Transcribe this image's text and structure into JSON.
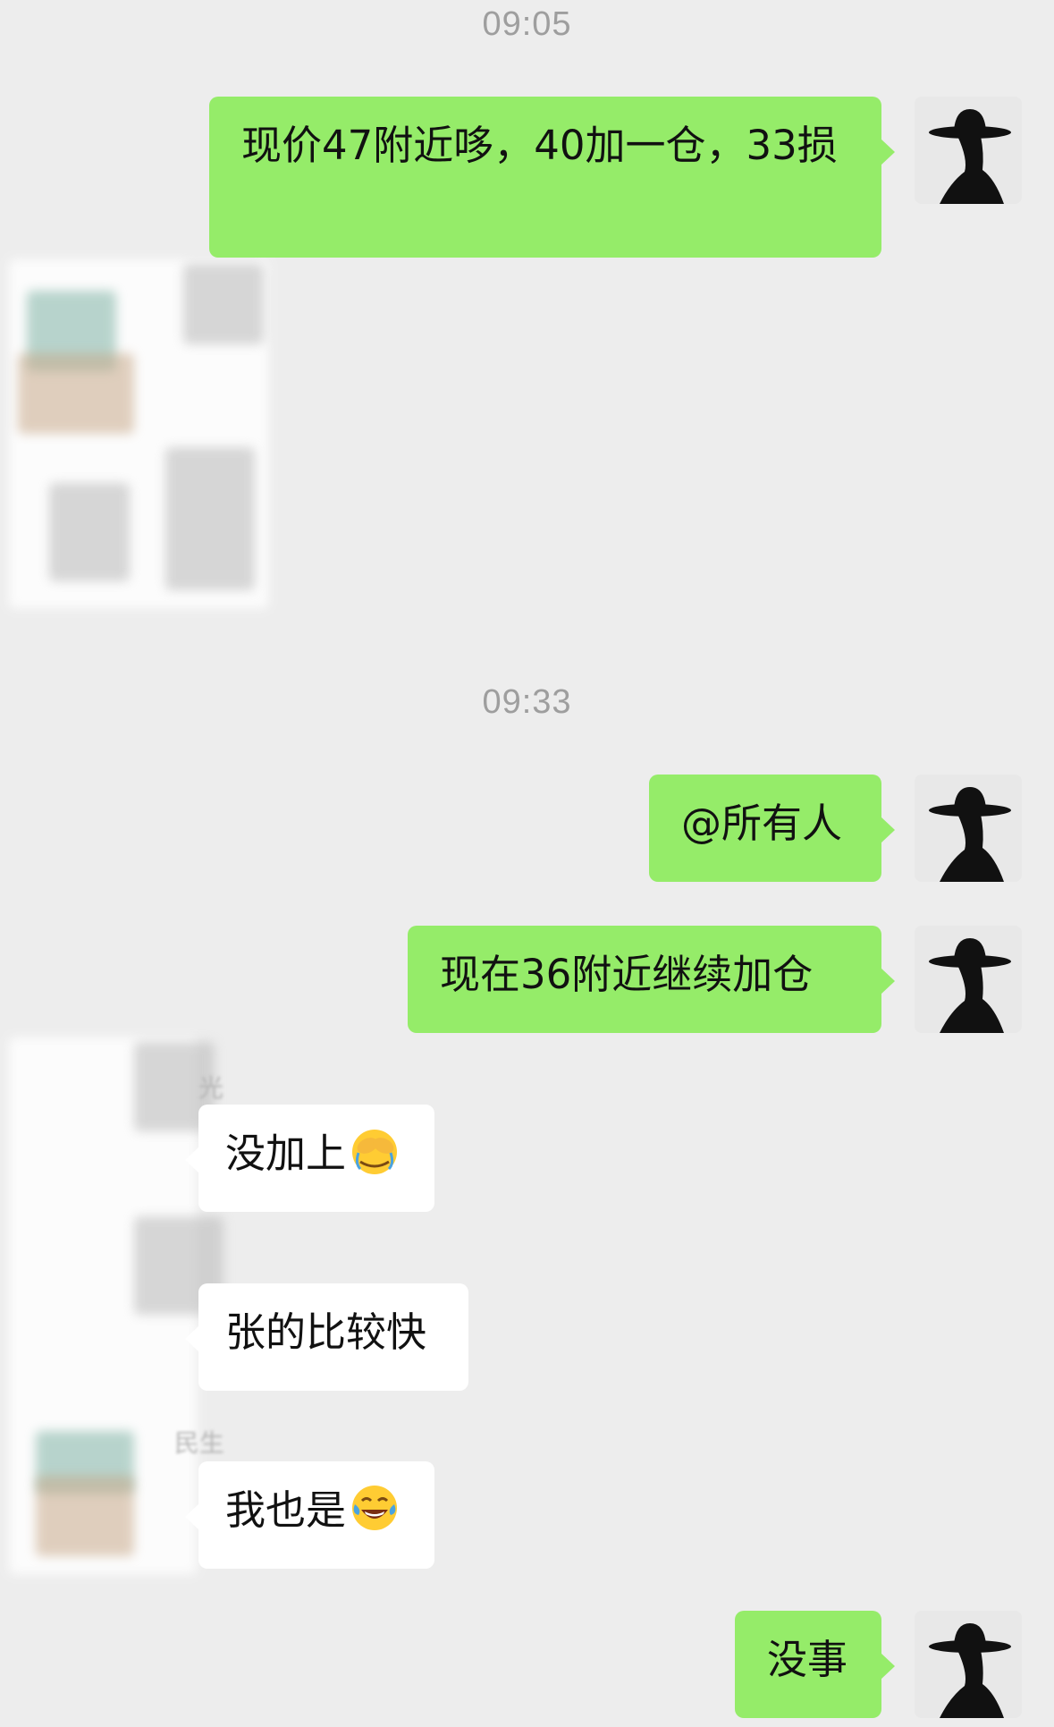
{
  "chat": {
    "timestamp_1": "09:05",
    "msg_1": "现价47附近哆，40加一仓，33损",
    "timestamp_2": "09:33",
    "msg_2": "@所有人",
    "msg_3": "现在36附近继续加仓",
    "reply_1": {
      "sender": "光",
      "text": "没加上",
      "emoji": "facepalm-emoji"
    },
    "reply_2": {
      "sender": "",
      "text": "张的比较快"
    },
    "reply_3": {
      "sender": "民生",
      "text": "我也是",
      "emoji": "tears-of-joy-emoji"
    },
    "msg_4": "没事"
  },
  "colors": {
    "background": "#ededed",
    "outgoing_bubble": "#95ec69",
    "incoming_bubble": "#ffffff",
    "timestamp": "#9e9e9e",
    "text": "#111111"
  }
}
